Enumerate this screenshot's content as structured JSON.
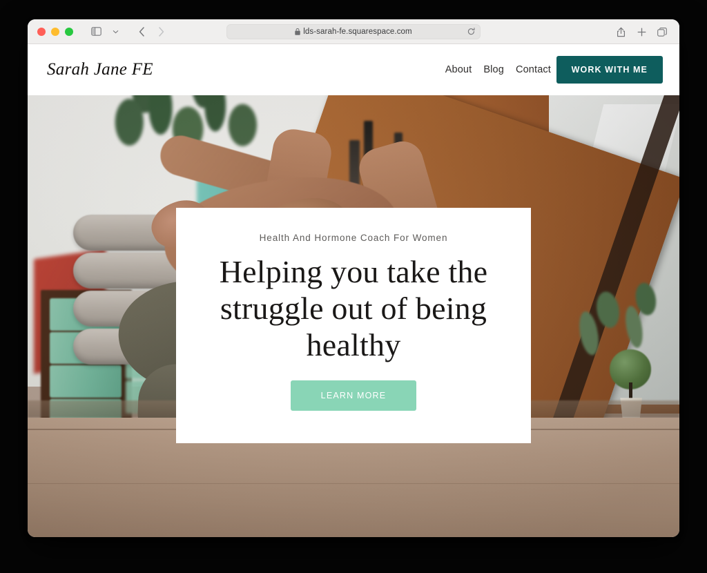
{
  "browser": {
    "window_controls": [
      "close",
      "minimize",
      "maximize"
    ],
    "sidebar_icon": "sidebar-toggle-icon",
    "dropdown_icon": "chevron-down-icon",
    "back_icon": "back-arrow-icon",
    "forward_icon": "forward-arrow-icon",
    "url": "lds-sarah-fe.squarespace.com",
    "lock_icon": "lock-icon",
    "reload_icon": "reload-icon",
    "share_icon": "share-icon",
    "new_tab_icon": "plus-icon",
    "tabs_icon": "tab-overview-icon"
  },
  "site": {
    "logo": "Sarah Jane FE",
    "nav": [
      {
        "label": "About"
      },
      {
        "label": "Blog"
      },
      {
        "label": "Contact"
      }
    ],
    "cta_label": "WORK WITH ME",
    "cta_color": "#0e5d5d"
  },
  "hero": {
    "eyebrow": "Health And Hormone Coach For Women",
    "headline": "Helping you take the struggle out of being healthy",
    "button_label": "LEARN MORE",
    "button_color": "#89d5b6",
    "image_alt": "Woman in a yoga backbend pose on a wooden floor in a studio"
  }
}
